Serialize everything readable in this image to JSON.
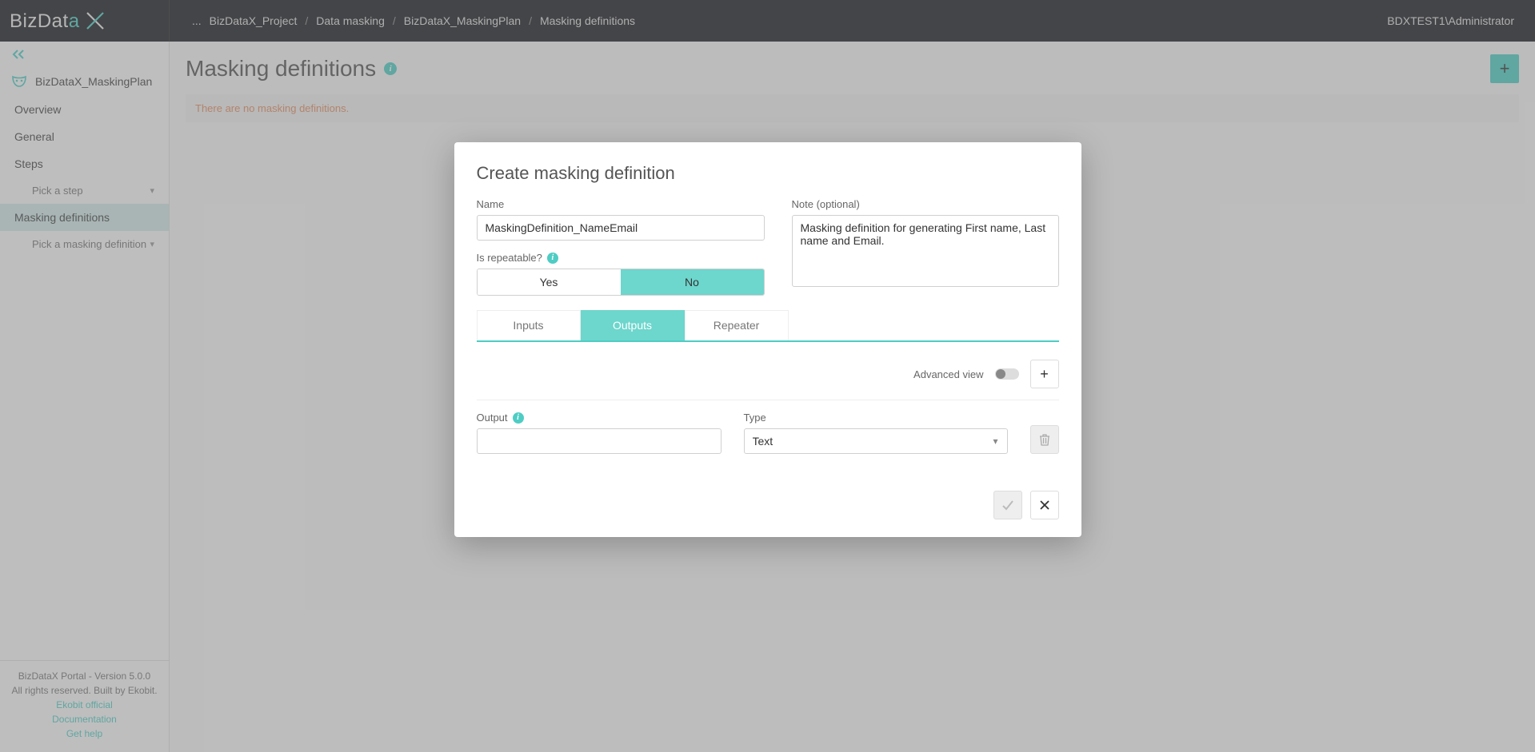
{
  "header": {
    "logo_pre": "BizDat",
    "logo_accent": "a",
    "breadcrumbs": [
      "BizDataX_Project",
      "Data masking",
      "BizDataX_MaskingPlan",
      "Masking definitions"
    ],
    "ellipsis": "...",
    "user": "BDXTEST1\\Administrator"
  },
  "sidebar": {
    "plan_name": "BizDataX_MaskingPlan",
    "items": [
      {
        "label": "Overview"
      },
      {
        "label": "General"
      },
      {
        "label": "Steps"
      }
    ],
    "step_picker": "Pick a step",
    "active": "Masking definitions",
    "def_picker": "Pick a masking definition",
    "footer": {
      "line1": "BizDataX Portal - Version 5.0.0",
      "line2": "All rights reserved. Built by Ekobit.",
      "link1": "Ekobit official",
      "link2": "Documentation",
      "link3": "Get help"
    }
  },
  "page": {
    "title": "Masking definitions",
    "empty_msg": "There are no masking definitions."
  },
  "modal": {
    "title": "Create masking definition",
    "name_label": "Name",
    "name_value": "MaskingDefinition_NameEmail",
    "note_label": "Note (optional)",
    "note_value": "Masking definition for generating First name, Last name and Email.",
    "repeat_label": "Is repeatable?",
    "repeat_yes": "Yes",
    "repeat_no": "No",
    "tabs": {
      "inputs": "Inputs",
      "outputs": "Outputs",
      "repeater": "Repeater"
    },
    "advanced_label": "Advanced view",
    "output_label": "Output",
    "type_label": "Type",
    "type_value": "Text"
  }
}
